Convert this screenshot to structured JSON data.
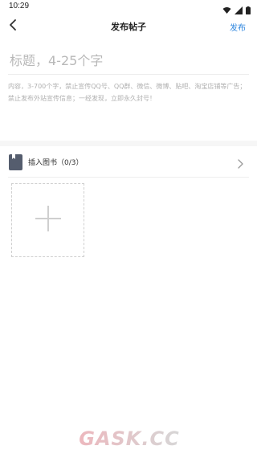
{
  "status_bar": {
    "time": "10:29"
  },
  "nav": {
    "title": "发布帖子",
    "publish_label": "发布",
    "accent_color": "#2e86de"
  },
  "form": {
    "title_placeholder": "标题，4-25个字",
    "content_placeholder": "内容，3-700个字，禁止宣传QQ号、QQ群、微信、微博、贴吧、淘宝店铺等广告；禁止发布外站宣传信息；一经发现，立即永久封号！"
  },
  "insert_book": {
    "label": "插入图书（0/3）"
  },
  "watermark": {
    "text": "GASK.CC"
  }
}
